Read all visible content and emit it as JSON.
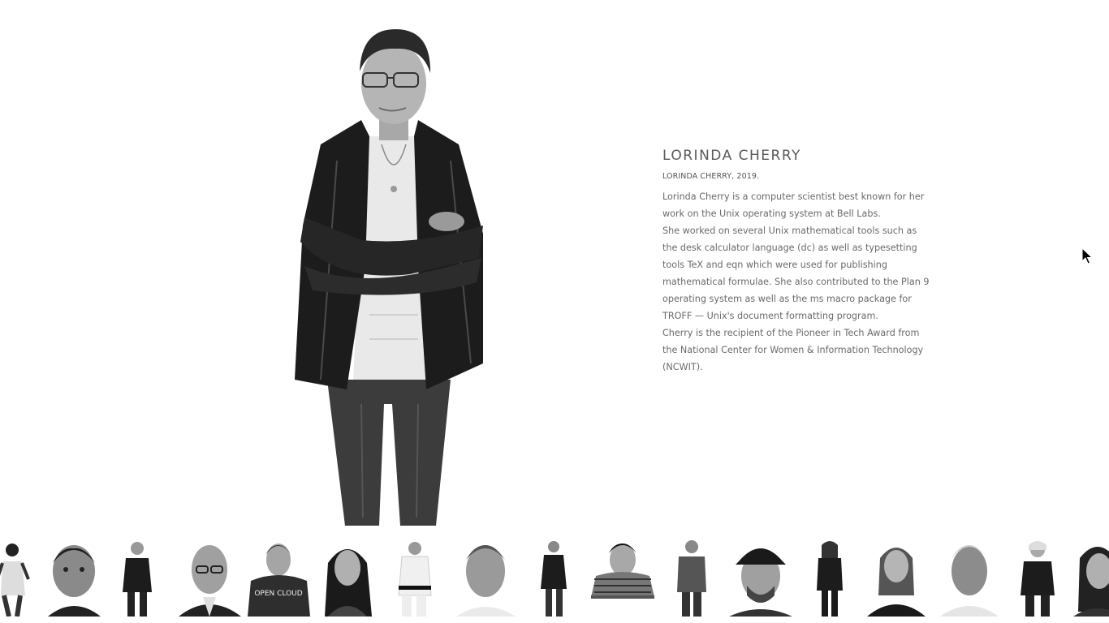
{
  "profile": {
    "name": "LORINDA CHERRY",
    "caption": "LORINDA CHERRY, 2019.",
    "paragraphs": [
      "Lorinda Cherry is a computer scientist best known for her work on the Unix operating system at Bell Labs.",
      "She worked on several Unix mathematical tools such as the desk calculator language (dc) as well as typesetting tools TeX and eqn which were used for publishing mathematical formulae. She also contributed to the Plan 9 operating system as well as the ms macro package for TROFF — Unix's document formatting program.",
      "Cherry is the recipient of the Pioneer in Tech Award from the National Center for Women & Information Technology (NCWIT)."
    ]
  },
  "thumbnails": [
    {
      "style": "full-body"
    },
    {
      "style": "headshot"
    },
    {
      "style": "full-body"
    },
    {
      "style": "headshot"
    },
    {
      "style": "bust",
      "shirt_text": "OPEN CLOUD"
    },
    {
      "style": "bust"
    },
    {
      "style": "full-body"
    },
    {
      "style": "headshot"
    },
    {
      "style": "full-body"
    },
    {
      "style": "bust"
    },
    {
      "style": "full-body"
    },
    {
      "style": "headshot"
    },
    {
      "style": "full-body"
    },
    {
      "style": "bust"
    },
    {
      "style": "headshot"
    },
    {
      "style": "full-body"
    },
    {
      "style": "headshot"
    }
  ],
  "icons": {
    "cursor": "mouse-pointer-icon"
  }
}
